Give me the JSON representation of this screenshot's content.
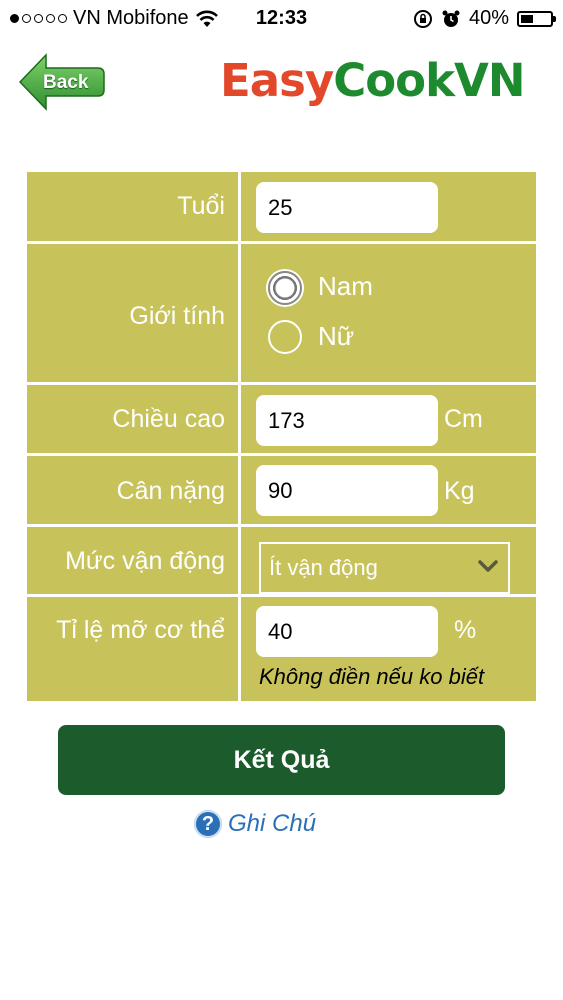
{
  "status_bar": {
    "carrier": "VN Mobifone",
    "time": "12:33",
    "battery": "40%",
    "signal_dots_filled": 1,
    "signal_dots_total": 5
  },
  "header": {
    "back_label": "Back",
    "logo_part1": "Easy",
    "logo_part2": "CookVN"
  },
  "form": {
    "age": {
      "label": "Tuổi",
      "value": "25"
    },
    "gender": {
      "label": "Giới tính",
      "options": [
        "Nam",
        "Nữ"
      ],
      "selected": "Nam"
    },
    "height": {
      "label": "Chiều cao",
      "value": "173",
      "unit": "Cm"
    },
    "weight": {
      "label": "Cân nặng",
      "value": "90",
      "unit": "Kg"
    },
    "activity": {
      "label": "Mức vận động",
      "value": "Ít vận động"
    },
    "bodyfat": {
      "label": "Tỉ lệ mỡ cơ thể",
      "value": "40",
      "unit": "%",
      "hint": "Không điền nếu ko biết"
    }
  },
  "actions": {
    "result_label": "Kết Quả",
    "note_label": "Ghi Chú",
    "note_icon": "?"
  },
  "colors": {
    "panel": "#c7c35a",
    "button": "#1c5b2c",
    "logo_red": "#e2492b",
    "logo_green": "#1d8a2e",
    "link_blue": "#2a6fb8"
  }
}
